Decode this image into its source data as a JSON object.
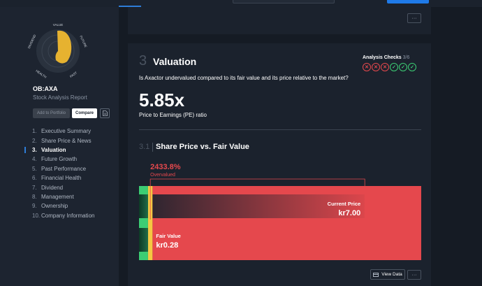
{
  "sidebar": {
    "ticker": "OB:AXA",
    "subtitle": "Stock Analysis Report",
    "add_label": "Add to Portfolio",
    "compare_label": "Compare",
    "snowflake_labels": [
      "VALUE",
      "FUTURE",
      "PAST",
      "HEALTH",
      "DIVIDEND"
    ],
    "nav": [
      {
        "num": "1.",
        "label": "Executive Summary"
      },
      {
        "num": "2.",
        "label": "Share Price & News"
      },
      {
        "num": "3.",
        "label": "Valuation"
      },
      {
        "num": "4.",
        "label": "Future Growth"
      },
      {
        "num": "5.",
        "label": "Past Performance"
      },
      {
        "num": "6.",
        "label": "Financial Health"
      },
      {
        "num": "7.",
        "label": "Dividend"
      },
      {
        "num": "8.",
        "label": "Management"
      },
      {
        "num": "9.",
        "label": "Ownership"
      },
      {
        "num": "10.",
        "label": "Company Information"
      }
    ],
    "active_index": 2
  },
  "top_card": {
    "more_label": "···"
  },
  "valuation": {
    "section_number": "3",
    "title": "Valuation",
    "description": "Is Axactor undervalued compared to its fair value and its price relative to the market?",
    "checks_label": "Analysis Checks",
    "checks_fraction": "3/6",
    "checks": [
      "fail",
      "fail",
      "fail",
      "pass",
      "pass",
      "pass"
    ],
    "pe_value": "5.85x",
    "pe_label": "Price to Earnings (PE) ratio",
    "sub_number": "3.1",
    "sub_title": "Share Price vs. Fair Value",
    "view_data_label": "View Data",
    "more_label": "···"
  },
  "chart_data": {
    "type": "bar",
    "series": [
      {
        "name": "Current Price",
        "label": "Current Price",
        "display": "kr7.00",
        "value": 7.0
      },
      {
        "name": "Fair Value",
        "label": "Fair Value",
        "display": "kr0.28",
        "value": 0.28
      }
    ],
    "annotation": {
      "value": "2433.8%",
      "label": "Overvalued"
    },
    "colors": {
      "undervalued": "#3ccd74",
      "fair": "#f5c842",
      "overvalued": "#e5484d"
    }
  },
  "colors": {
    "accent": "#2e7dd7",
    "danger": "#e5484d",
    "success": "#3ccd74",
    "snowflake": "#e6b230"
  }
}
